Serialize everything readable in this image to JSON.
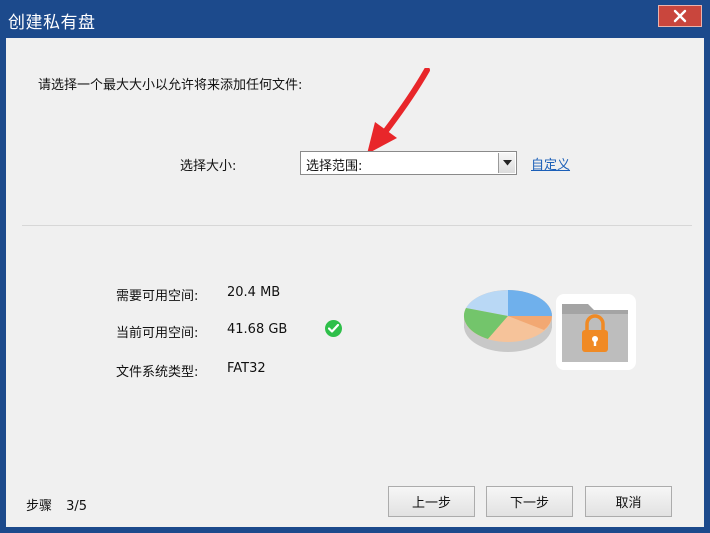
{
  "window": {
    "title": "创建私有盘"
  },
  "instruction": "请选择一个最大大小以允许将来添加任何文件:",
  "size": {
    "label": "选择大小:",
    "selected": "选择范围:",
    "custom_link": "自定义"
  },
  "info": {
    "required_label": "需要可用空间:",
    "required_value": "20.4 MB",
    "available_label": "当前可用空间:",
    "available_value": "41.68 GB",
    "fs_label": "文件系统类型:",
    "fs_value": "FAT32"
  },
  "footer": {
    "step_label": "步骤",
    "step_value": "3/5",
    "prev_label": "上一步",
    "next_label": "下一步",
    "cancel_label": "取消"
  },
  "colors": {
    "titlebar": "#1c4a8c",
    "close": "#c9463d",
    "link": "#1b5fb8",
    "check": "#2fbf4a",
    "arrow": "#e8262a",
    "lock": "#f08a24"
  }
}
